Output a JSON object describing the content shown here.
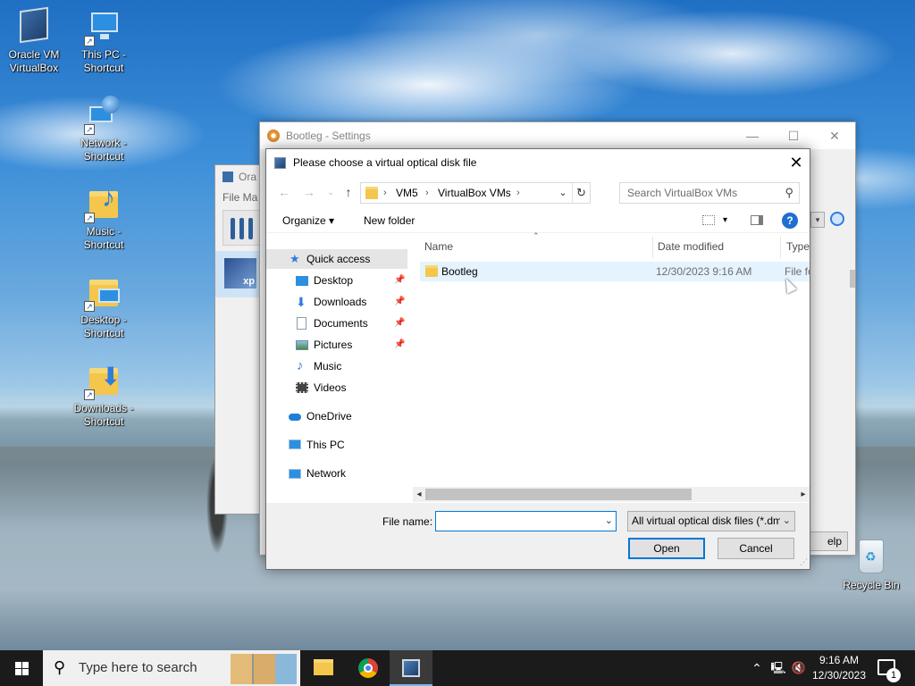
{
  "desktop": {
    "icons": [
      {
        "label": "Oracle VM\nVirtualBox"
      },
      {
        "label": "This PC -\nShortcut"
      },
      {
        "label": "Network -\nShortcut"
      },
      {
        "label": "Music -\nShortcut"
      },
      {
        "label": "Desktop -\nShortcut"
      },
      {
        "label": "Downloads -\nShortcut"
      },
      {
        "label": "Recycle Bin"
      }
    ]
  },
  "manager_window": {
    "title": "Ora",
    "menu": "File  Ma",
    "vm_badge": "xp"
  },
  "settings_window": {
    "title": "Bootleg - Settings",
    "help_fragment": "elp"
  },
  "dialog": {
    "title": "Please choose a virtual optical disk file",
    "address": {
      "crumbs": [
        "VM5",
        "VirtualBox VMs"
      ]
    },
    "search": {
      "placeholder": "Search VirtualBox VMs"
    },
    "toolbar": {
      "organize": "Organize",
      "new_folder": "New folder"
    },
    "nav": {
      "quick_access": "Quick access",
      "pinned": [
        {
          "label": "Desktop"
        },
        {
          "label": "Downloads"
        },
        {
          "label": "Documents"
        },
        {
          "label": "Pictures"
        }
      ],
      "music": "Music",
      "videos": "Videos",
      "onedrive": "OneDrive",
      "this_pc": "This PC",
      "network": "Network"
    },
    "columns": {
      "name": "Name",
      "date": "Date modified",
      "type": "Type"
    },
    "rows": [
      {
        "name": "Bootleg",
        "date": "12/30/2023 9:16 AM",
        "type": "File folder"
      }
    ],
    "file_name": {
      "label": "File name:",
      "value": ""
    },
    "file_type": "All virtual optical disk files (*.dmg *.iso *.cdr)",
    "open": "Open",
    "cancel": "Cancel"
  },
  "taskbar": {
    "search_placeholder": "Type here to search",
    "time": "9:16 AM",
    "date": "12/30/2023",
    "notification_count": "1"
  }
}
